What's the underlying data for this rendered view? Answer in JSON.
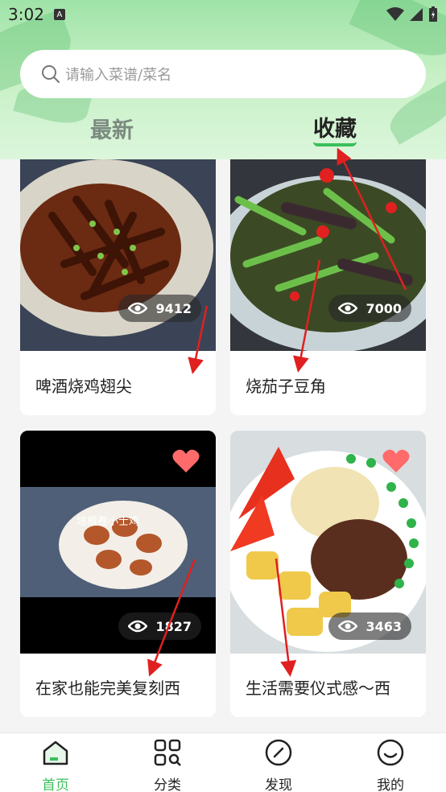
{
  "status_bar": {
    "time": "3:02",
    "badge": "A"
  },
  "search": {
    "placeholder": "请输入菜谱/菜名"
  },
  "tabs": [
    {
      "label": "最新",
      "active": false
    },
    {
      "label": "收藏",
      "active": true
    }
  ],
  "cards": [
    {
      "title": "啤酒烧鸡翅尖",
      "views": "9412",
      "favorited": false
    },
    {
      "title": "烧茄子豆角",
      "views": "7000",
      "favorited": false
    },
    {
      "title": "在家也能完美复刻西",
      "views": "1827",
      "favorited": true,
      "image_text": "培根卷小士鸡"
    },
    {
      "title": "生活需要仪式感～西",
      "views": "3463",
      "favorited": true
    }
  ],
  "bottom_nav": [
    {
      "label": "首页",
      "icon": "home-icon",
      "active": true
    },
    {
      "label": "分类",
      "icon": "category-icon",
      "active": false
    },
    {
      "label": "发现",
      "icon": "compass-icon",
      "active": false
    },
    {
      "label": "我的",
      "icon": "profile-icon",
      "active": false
    }
  ],
  "colors": {
    "accent": "#3bbf5c",
    "heart": "#ff6a6a",
    "arrow": "#e02020"
  }
}
